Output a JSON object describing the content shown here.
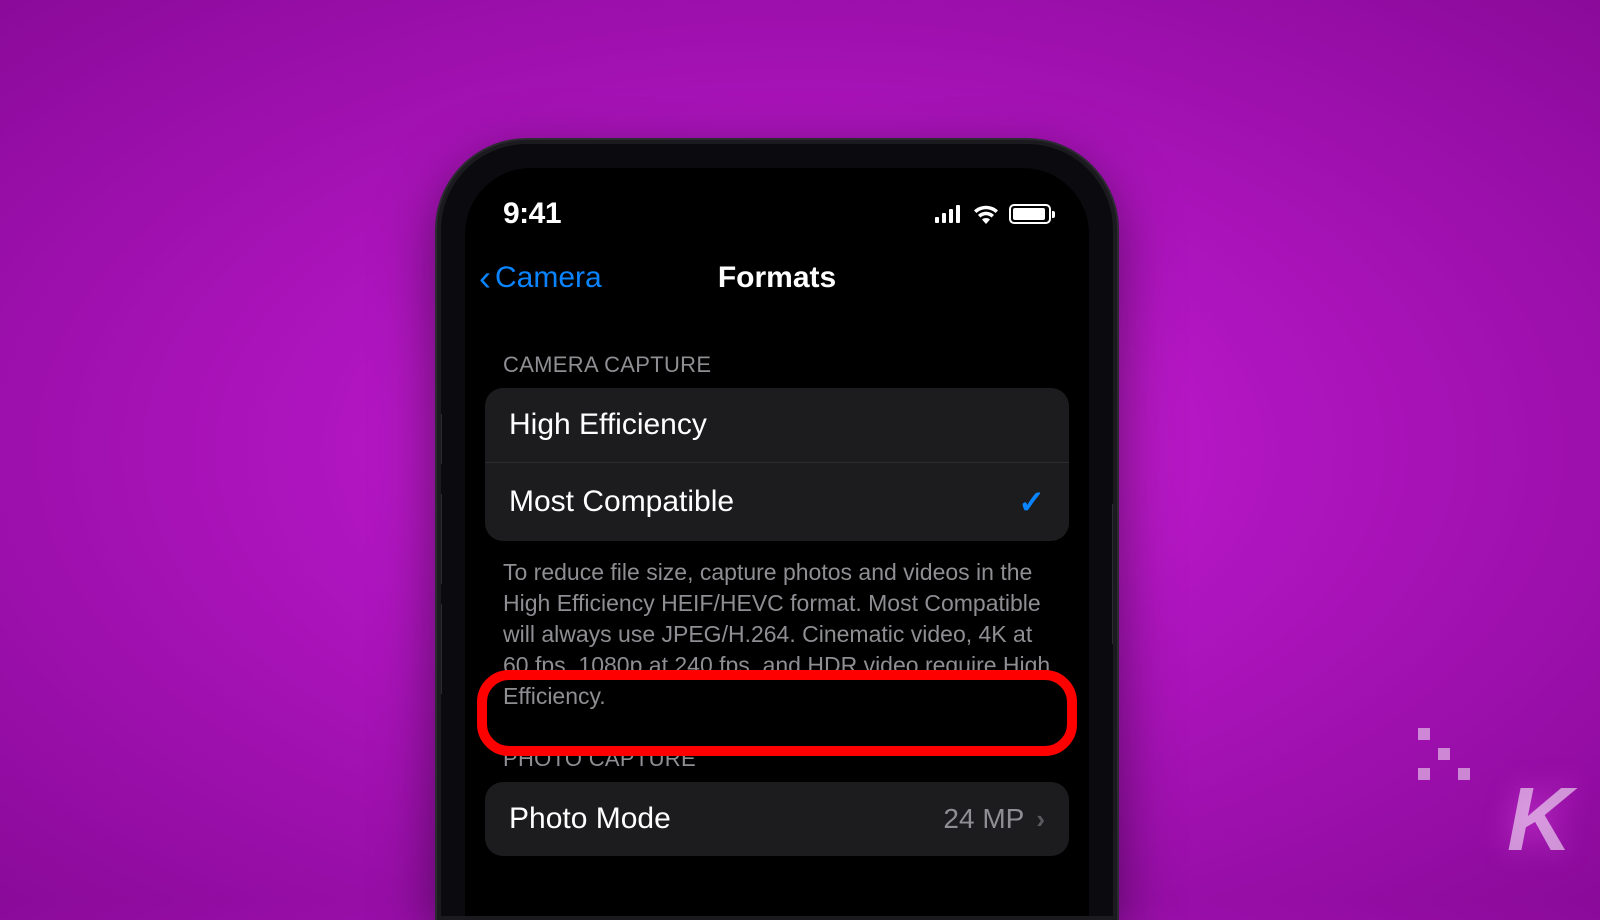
{
  "status": {
    "time": "9:41"
  },
  "nav": {
    "back_label": "Camera",
    "title": "Formats"
  },
  "sections": {
    "camera_capture": {
      "header": "CAMERA CAPTURE",
      "rows": {
        "high_efficiency": "High Efficiency",
        "most_compatible": "Most Compatible"
      },
      "footer": "To reduce file size, capture photos and videos in the High Efficiency HEIF/HEVC format. Most Compatible will always use JPEG/H.264. Cinematic video, 4K at 60 fps, 1080p at 240 fps, and HDR video require High Efficiency."
    },
    "photo_capture": {
      "header": "PHOTO CAPTURE",
      "photo_mode": {
        "label": "Photo Mode",
        "value": "24 MP"
      }
    }
  },
  "watermark": "K"
}
